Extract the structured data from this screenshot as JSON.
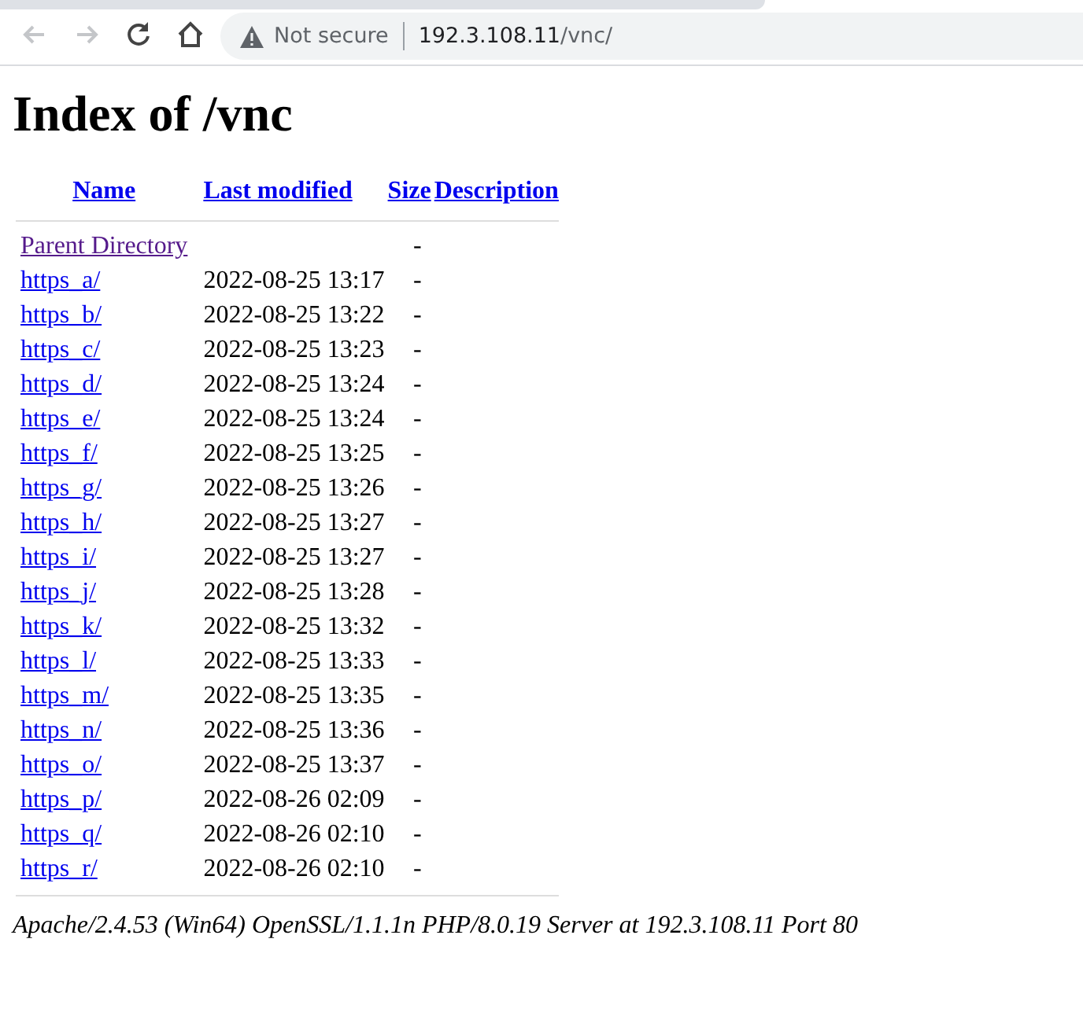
{
  "browser": {
    "back_disabled": true,
    "forward_disabled": true,
    "security": "Not secure",
    "host": "192.3.108.11",
    "path": "/vnc/"
  },
  "title": "Index of /vnc",
  "table": {
    "columns": [
      "Name",
      "Last modified",
      "Size",
      "Description"
    ],
    "rows": [
      {
        "name": "Parent Directory",
        "modified": "",
        "size": "-",
        "visited": true
      },
      {
        "name": "https_a/",
        "modified": "2022-08-25 13:17",
        "size": "-",
        "visited": false
      },
      {
        "name": "https_b/",
        "modified": "2022-08-25 13:22",
        "size": "-",
        "visited": false
      },
      {
        "name": "https_c/",
        "modified": "2022-08-25 13:23",
        "size": "-",
        "visited": false
      },
      {
        "name": "https_d/",
        "modified": "2022-08-25 13:24",
        "size": "-",
        "visited": false
      },
      {
        "name": "https_e/",
        "modified": "2022-08-25 13:24",
        "size": "-",
        "visited": false
      },
      {
        "name": "https_f/",
        "modified": "2022-08-25 13:25",
        "size": "-",
        "visited": false
      },
      {
        "name": "https_g/",
        "modified": "2022-08-25 13:26",
        "size": "-",
        "visited": false
      },
      {
        "name": "https_h/",
        "modified": "2022-08-25 13:27",
        "size": "-",
        "visited": false
      },
      {
        "name": "https_i/",
        "modified": "2022-08-25 13:27",
        "size": "-",
        "visited": false
      },
      {
        "name": "https_j/",
        "modified": "2022-08-25 13:28",
        "size": "-",
        "visited": false
      },
      {
        "name": "https_k/",
        "modified": "2022-08-25 13:32",
        "size": "-",
        "visited": false
      },
      {
        "name": "https_l/",
        "modified": "2022-08-25 13:33",
        "size": "-",
        "visited": false
      },
      {
        "name": "https_m/",
        "modified": "2022-08-25 13:35",
        "size": "-",
        "visited": false
      },
      {
        "name": "https_n/",
        "modified": "2022-08-25 13:36",
        "size": "-",
        "visited": false
      },
      {
        "name": "https_o/",
        "modified": "2022-08-25 13:37",
        "size": "-",
        "visited": false
      },
      {
        "name": "https_p/",
        "modified": "2022-08-26 02:09",
        "size": "-",
        "visited": false
      },
      {
        "name": "https_q/",
        "modified": "2022-08-26 02:10",
        "size": "-",
        "visited": false
      },
      {
        "name": "https_r/",
        "modified": "2022-08-26 02:10",
        "size": "-",
        "visited": false
      }
    ]
  },
  "footer": "Apache/2.4.53 (Win64) OpenSSL/1.1.1n PHP/8.0.19 Server at 192.3.108.11 Port 80"
}
